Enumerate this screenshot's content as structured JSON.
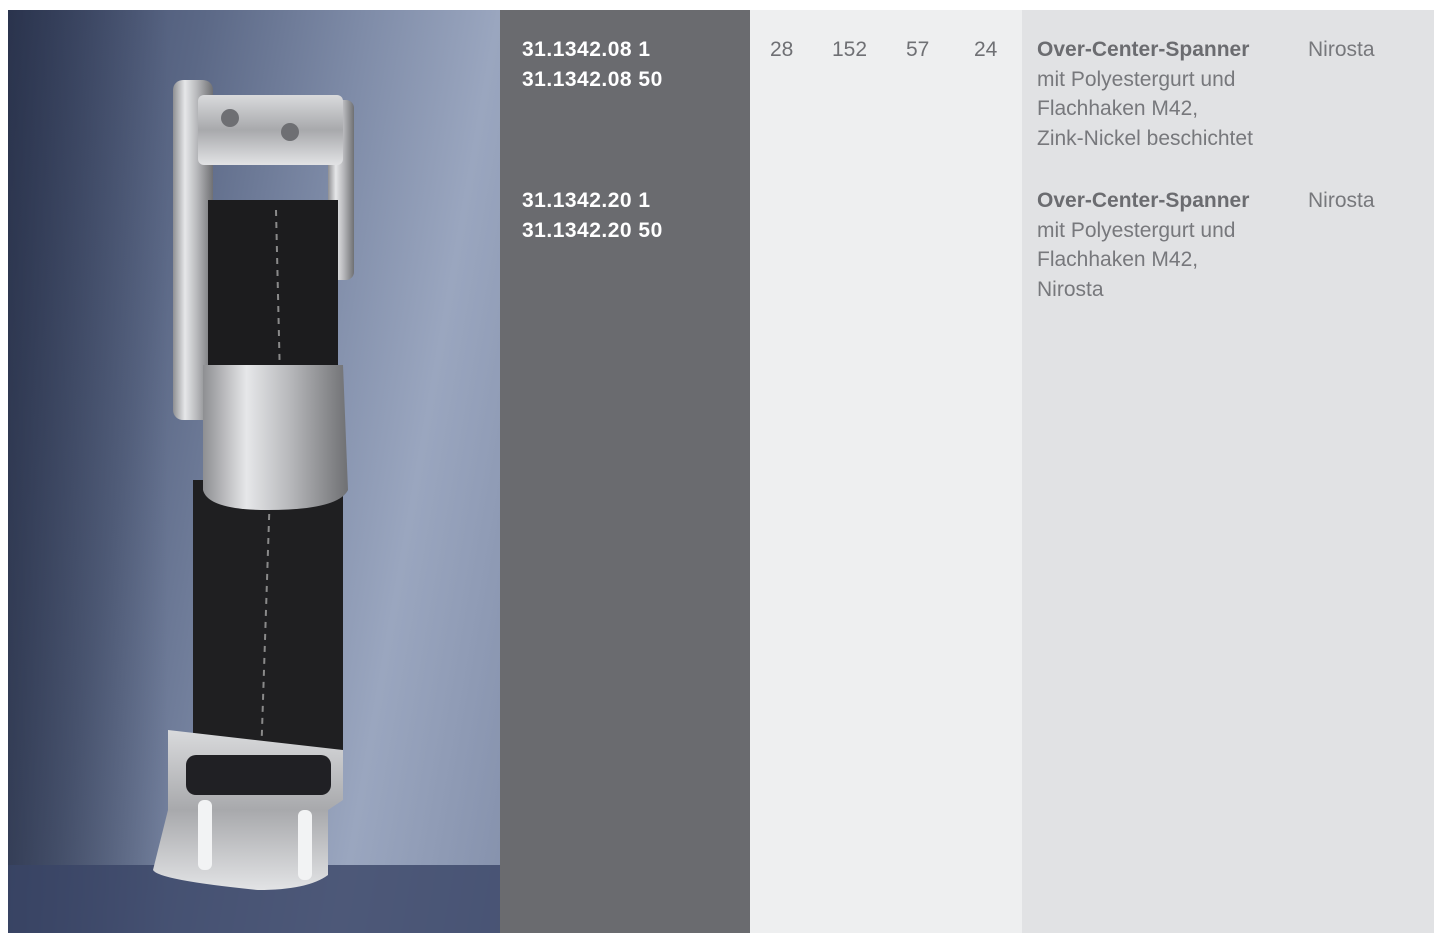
{
  "products": [
    {
      "article_numbers": [
        "31.1342.08 1",
        "31.1342.08 50"
      ],
      "dimensions": [
        "28",
        "152",
        "57",
        "24"
      ],
      "name": "Over-Center-Spanner",
      "description_lines": [
        "mit Polyestergurt und",
        "Flachhaken M42,",
        "Zink-Nickel beschichtet"
      ],
      "material": "Nirosta"
    },
    {
      "article_numbers": [
        "31.1342.20 1",
        "31.1342.20 50"
      ],
      "dimensions": [],
      "name": "Over-Center-Spanner",
      "description_lines": [
        "mit Polyestergurt und",
        "Flachhaken M42,",
        "Nirosta"
      ],
      "material": "Nirosta"
    }
  ],
  "colors": {
    "article_column": "#6a6b6f",
    "dimension_column": "#eeeff0",
    "description_column": "#e1e2e4"
  }
}
